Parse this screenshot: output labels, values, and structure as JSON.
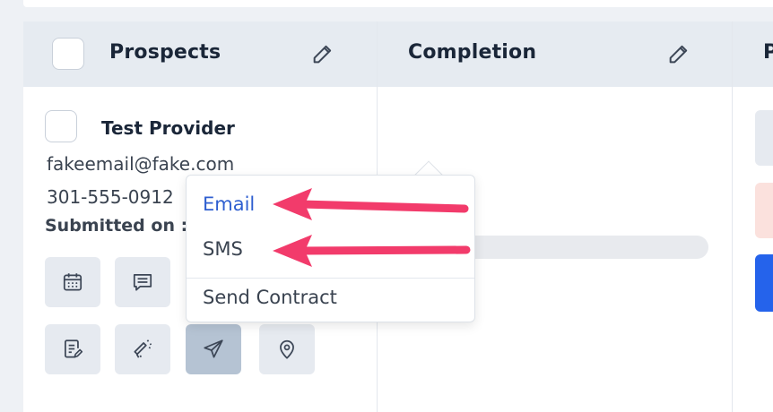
{
  "columns": {
    "prospects": {
      "title": "Prospects"
    },
    "completion": {
      "title": "Completion"
    },
    "next": {
      "title": "P"
    }
  },
  "card": {
    "name": "Test Provider",
    "email": "fakeemail@fake.com",
    "phone": "301-555-0912",
    "submitted_label": "Submitted on :"
  },
  "actions": [
    {
      "icon": "calendar-icon"
    },
    {
      "icon": "message-icon"
    },
    {
      "icon": "document-edit-icon"
    },
    {
      "icon": "megaphone-icon"
    },
    {
      "icon": "send-icon"
    },
    {
      "icon": "location-pin-icon"
    }
  ],
  "dropdown": {
    "items": [
      "Email",
      "SMS",
      "Send Contract"
    ]
  },
  "colors": {
    "accent_link": "#2f5fd0",
    "annotation_arrow": "#f23b6b",
    "primary_button": "#2563eb",
    "danger_tint": "#fbe1dd"
  }
}
